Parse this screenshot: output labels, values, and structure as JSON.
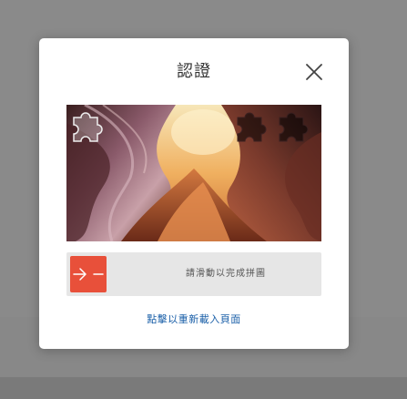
{
  "dialog": {
    "title": "認證",
    "close_icon": "close-icon"
  },
  "captcha": {
    "image_description_icon": "puzzle-piece-icon",
    "slider_hint": "請滑動以完成拼圖",
    "handle_icon": "arrow-right-icon",
    "progress": 0
  },
  "footer": {
    "reload_label": "點擊以重新載入頁面"
  },
  "colors": {
    "handle": "#e8503a",
    "link": "#1a5fa8",
    "track": "#e6e6e6"
  }
}
